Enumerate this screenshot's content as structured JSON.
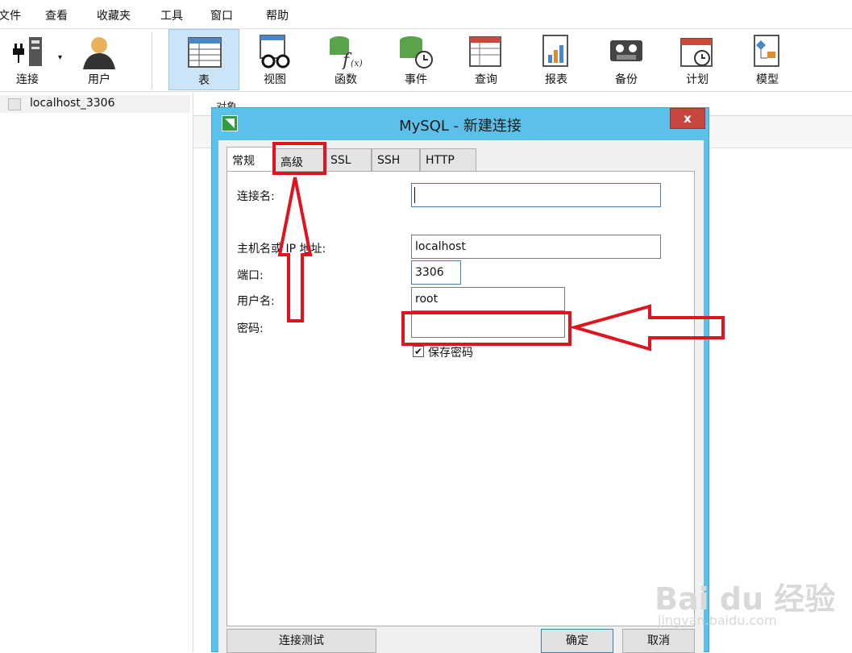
{
  "menu": [
    "文件",
    "查看",
    "收藏夹",
    "工具",
    "窗口",
    "帮助"
  ],
  "toolbar": {
    "connect": "连接",
    "user": "用户",
    "table": "表",
    "view": "视图",
    "function": "函数",
    "event": "事件",
    "query": "查询",
    "report": "报表",
    "backup": "备份",
    "schedule": "计划",
    "model": "模型"
  },
  "sidebar": {
    "connection": "localhost_3306"
  },
  "object_tab": "对象",
  "dialog": {
    "title": "MySQL - 新建连接",
    "close": "x",
    "tabs": [
      "常规",
      "高级",
      "SSL",
      "SSH",
      "HTTP"
    ],
    "fields": {
      "conn_name_label": "连接名:",
      "conn_name_value": "",
      "host_label": "主机名或 IP 地址:",
      "host_value": "localhost",
      "port_label": "端口:",
      "port_value": "3306",
      "user_label": "用户名:",
      "user_value": "root",
      "password_label": "密码:",
      "password_value": "",
      "save_password_label": "保存密码",
      "save_password_checked": true
    },
    "buttons": {
      "test": "连接测试",
      "ok": "确定",
      "cancel": "取消"
    }
  },
  "annotation_color": "#e0141e",
  "watermark": {
    "brand": "Bai du 经验",
    "url": "jingyan.baidu.com"
  }
}
